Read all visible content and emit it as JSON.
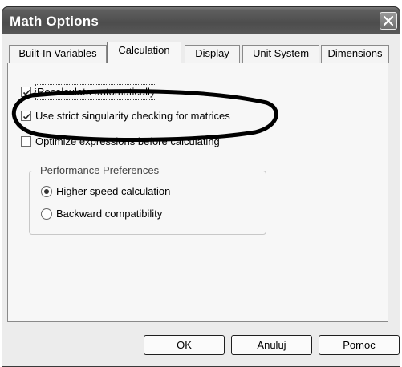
{
  "window": {
    "title": "Math Options"
  },
  "tabs": [
    {
      "label": "Built-In Variables",
      "active": false
    },
    {
      "label": "Calculation",
      "active": true
    },
    {
      "label": "Display",
      "active": false
    },
    {
      "label": "Unit System",
      "active": false
    },
    {
      "label": "Dimensions",
      "active": false
    }
  ],
  "options": [
    {
      "label": "Recalculate automatically",
      "checked": true
    },
    {
      "label": "Use strict singularity checking for matrices",
      "checked": true
    },
    {
      "label": "Optimize expressions before calculating",
      "checked": false
    }
  ],
  "performance": {
    "legend": "Performance Preferences",
    "choices": [
      {
        "label": "Higher speed calculation",
        "selected": true
      },
      {
        "label": "Backward compatibility",
        "selected": false
      }
    ]
  },
  "buttons": {
    "ok": "OK",
    "cancel": "Anuluj",
    "help": "Pomoc"
  }
}
